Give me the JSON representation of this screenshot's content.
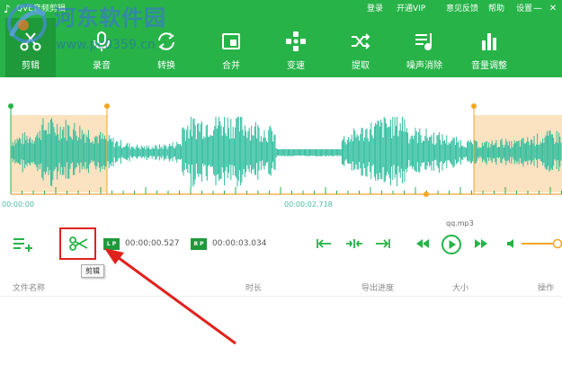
{
  "app": {
    "title": "QVE音频剪辑",
    "menu": [
      "登录",
      "开通VIP",
      "意见反馈",
      "帮助",
      "设置"
    ],
    "minimize_glyph": "—",
    "close_glyph": "✕"
  },
  "toolbar": {
    "items": [
      {
        "label": "剪辑",
        "icon": "scissors-icon",
        "active": true
      },
      {
        "label": "录音",
        "icon": "microphone-icon",
        "active": false
      },
      {
        "label": "转换",
        "icon": "convert-icon",
        "active": false
      },
      {
        "label": "合并",
        "icon": "merge-icon",
        "active": false
      },
      {
        "label": "变速",
        "icon": "speed-icon",
        "active": false
      },
      {
        "label": "提取",
        "icon": "extract-icon",
        "active": false
      },
      {
        "label": "噪声消除",
        "icon": "noise-icon",
        "active": false
      },
      {
        "label": "音量调整",
        "icon": "volume-bars-icon",
        "active": false
      }
    ]
  },
  "watermark": {
    "text": "河东软件园",
    "url": "www.pc0359.cn"
  },
  "timeline": {
    "start": "00:00:00",
    "middle": "00:00:02.718"
  },
  "player": {
    "file_name": "qq.mp3",
    "start_badge": "L P",
    "start_time": "00:00:00.527",
    "end_badge": "R P",
    "end_time": "00:00:03.034",
    "tooltip": "剪辑"
  },
  "table": {
    "headers": [
      "文件名称",
      "时长",
      "导出进度",
      "大小",
      "操作"
    ]
  },
  "colors": {
    "brand_green": "#27b348",
    "waveform": "#2bbc9c",
    "selection": "#fbe2c0",
    "marker": "#f5a623",
    "highlight_red": "#e0221d"
  }
}
